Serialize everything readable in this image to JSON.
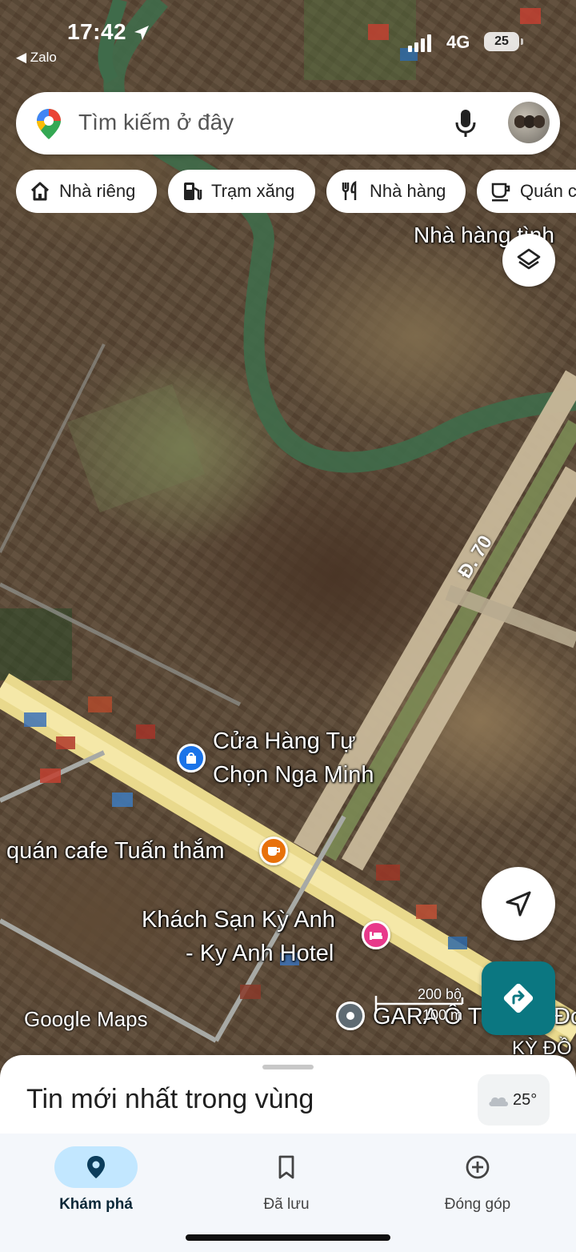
{
  "status_bar": {
    "time": "17:42",
    "back_app": "◀ Zalo",
    "network": "4G",
    "battery": "25"
  },
  "search": {
    "placeholder": "Tìm kiếm ở đây",
    "mic_icon": "mic-icon",
    "avatar_icon": "account-avatar"
  },
  "chips": [
    {
      "label": "Nhà riêng",
      "icon": "home-icon"
    },
    {
      "label": "Trạm xăng",
      "icon": "gas-station-icon"
    },
    {
      "label": "Nhà hàng",
      "icon": "restaurant-icon"
    },
    {
      "label": "Quán c",
      "icon": "cafe-icon"
    }
  ],
  "map": {
    "labels": {
      "restaurant_top": "Nhà hàng tình",
      "store_line1": "Cửa Hàng Tự",
      "store_line2": "Chọn Nga Minh",
      "cafe": "quán cafe Tuấn thắm",
      "hotel_line1": "Khách Sạn Kỳ Anh",
      "hotel_line2": "- Ky Anh Hotel",
      "garage": "GARA Ô T",
      "road": "Đ. 70",
      "right_edge_1": "Đo",
      "right_edge_2": "KỲ ĐỒ"
    },
    "watermark": "Google Maps",
    "scale_label": "200 bộ",
    "scale_label_2": "100 m"
  },
  "bottom_sheet": {
    "title": "Tin mới nhất trong vùng",
    "temperature": "25°"
  },
  "nav": [
    {
      "label": "Khám phá",
      "icon": "explore-pin-icon",
      "active": true
    },
    {
      "label": "Đã lưu",
      "icon": "bookmark-icon",
      "active": false
    },
    {
      "label": "Đóng góp",
      "icon": "add-circle-icon",
      "active": false
    }
  ],
  "colors": {
    "accent_active_pill": "#c2e7ff",
    "direction_button": "#0b7781",
    "poi_shopping": "#1a73e8",
    "poi_cafe": "#e8710a",
    "poi_hotel": "#e8398b",
    "poi_generic": "#5f6b73"
  }
}
